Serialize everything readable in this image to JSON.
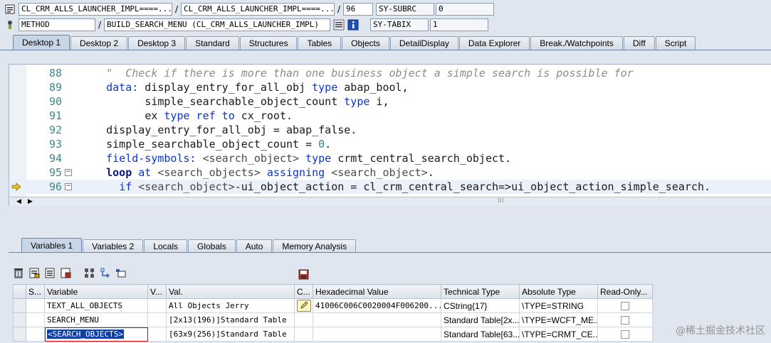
{
  "header": {
    "row1": {
      "class_field": "CL_CRM_ALLS_LAUNCHER_IMPL====...",
      "include_field": "CL_CRM_ALLS_LAUNCHER_IMPL====...",
      "line_field": "96",
      "sysvar_name": "SY-SUBRC",
      "sysvar_value": "0"
    },
    "row2": {
      "type_field": "METHOD",
      "method_field": "BUILD_SEARCH_MENU (CL_CRM_ALLS_LAUNCHER_IMPL)",
      "sysvar_name": "SY-TABIX",
      "sysvar_value": "1"
    },
    "separator": "/"
  },
  "main_tabs": [
    "Desktop 1",
    "Desktop 2",
    "Desktop 3",
    "Standard",
    "Structures",
    "Tables",
    "Objects",
    "DetailDisplay",
    "Data Explorer",
    "Break./Watchpoints",
    "Diff",
    "Script"
  ],
  "code": {
    "lines": [
      {
        "num": "88",
        "indent": "    ",
        "parts": [
          [
            "cm",
            "\"  Check if there is more than one business object a simple search is possible for"
          ]
        ]
      },
      {
        "num": "89",
        "indent": "    ",
        "parts": [
          [
            "kw",
            "data:"
          ],
          [
            "",
            " display_entry_for_all_obj "
          ],
          [
            "kw",
            "type"
          ],
          [
            "",
            " abap_bool,"
          ]
        ]
      },
      {
        "num": "90",
        "indent": "          ",
        "parts": [
          [
            "",
            "simple_searchable_object_count "
          ],
          [
            "kw",
            "type"
          ],
          [
            "",
            " i,"
          ]
        ]
      },
      {
        "num": "91",
        "indent": "          ",
        "parts": [
          [
            "",
            "ex "
          ],
          [
            "kw",
            "type ref to"
          ],
          [
            "",
            " cx_root."
          ]
        ]
      },
      {
        "num": "92",
        "indent": "    ",
        "parts": [
          [
            "",
            "display_entry_for_all_obj = abap_false."
          ]
        ]
      },
      {
        "num": "93",
        "indent": "    ",
        "parts": [
          [
            "",
            "simple_searchable_object_count = "
          ],
          [
            "num",
            "0"
          ],
          [
            "",
            "."
          ]
        ]
      },
      {
        "num": "94",
        "indent": "    ",
        "parts": [
          [
            "kw",
            "field-symbols:"
          ],
          [
            "",
            " "
          ],
          [
            "sym",
            "<search_object>"
          ],
          [
            "",
            " "
          ],
          [
            "kw",
            "type"
          ],
          [
            "",
            " crmt_central_search_object."
          ]
        ]
      },
      {
        "num": "95",
        "indent": "    ",
        "parts": [
          [
            "kwb",
            "loop"
          ],
          [
            "",
            " "
          ],
          [
            "kw",
            "at"
          ],
          [
            "",
            " "
          ],
          [
            "sym",
            "<search_objects>"
          ],
          [
            "",
            " "
          ],
          [
            "kw",
            "assigning"
          ],
          [
            "",
            " "
          ],
          [
            "sym",
            "<search_object>"
          ],
          [
            "",
            "."
          ]
        ]
      },
      {
        "num": "96",
        "indent": "      ",
        "parts": [
          [
            "kw",
            "if"
          ],
          [
            "",
            " "
          ],
          [
            "sym",
            "<search_object>"
          ],
          [
            "",
            "-ui_object_action = cl_crm_central_search=>ui_object_action_simple_search."
          ]
        ]
      }
    ]
  },
  "lower_tabs": [
    "Variables 1",
    "Variables 2",
    "Locals",
    "Globals",
    "Auto",
    "Memory Analysis"
  ],
  "grid": {
    "columns": [
      "S...",
      "Variable",
      "V...",
      "Val.",
      "C...",
      "Hexadecimal Value",
      "Technical Type",
      "Absolute Type",
      "Read-Only..."
    ],
    "rows": [
      {
        "variable": "TEXT_ALL_OBJECTS",
        "val": "All Objects Jerry",
        "hex": "41006C006C0020004F006200...",
        "tech": "CString{17}",
        "abs": "\\TYPE=STRING"
      },
      {
        "variable": "SEARCH_MENU",
        "val": "[2x13(196)]Standard Table",
        "hex": "",
        "tech": "Standard Table[2x...",
        "abs": "\\TYPE=WCFT_ME..."
      },
      {
        "variable": "<SEARCH_OBJECTS>",
        "val": "[63x9(256)]Standard Table",
        "hex": "",
        "tech": "Standard Table[63...",
        "abs": "\\TYPE=CRMT_CE..."
      }
    ]
  },
  "watermark": "@稀土掘金技术社区",
  "icons": {
    "row1": "class-icon",
    "row2": "method-icon",
    "toolbar": [
      "delete-icon",
      "save-variables-icon",
      "load-variables-icon",
      "import-icon",
      "hierarchy-icon",
      "navigate-icon",
      "display-icon"
    ],
    "save": "save-icon"
  }
}
